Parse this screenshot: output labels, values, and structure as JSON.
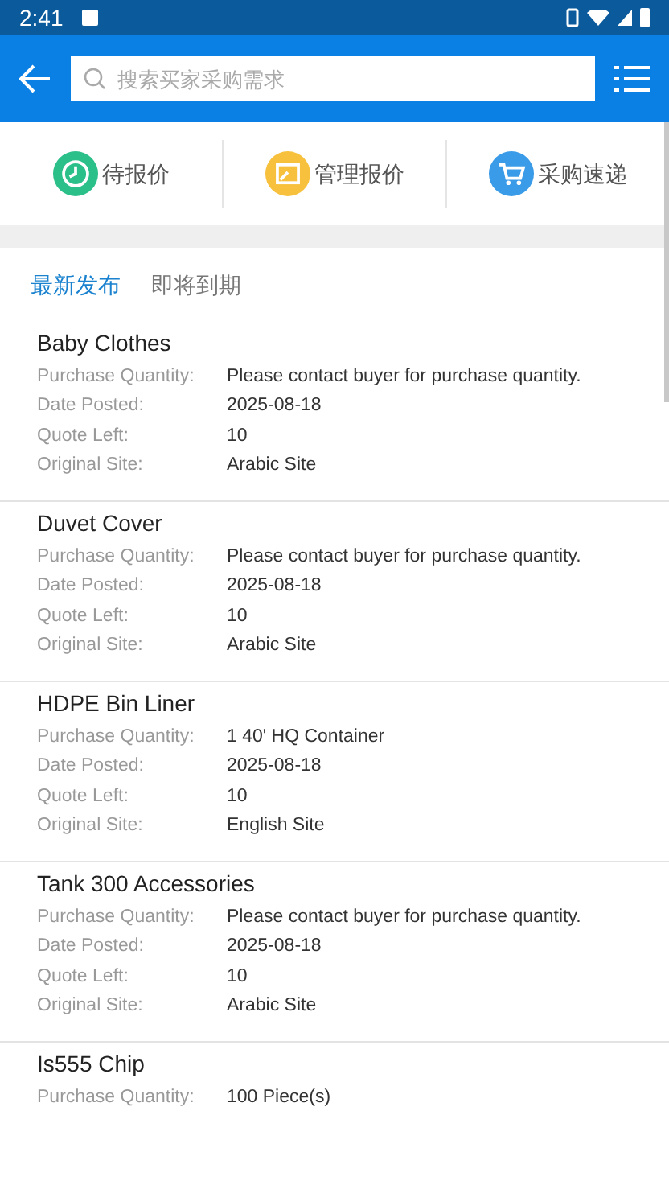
{
  "status_bar": {
    "time": "2:41"
  },
  "search": {
    "placeholder": "搜索买家采购需求"
  },
  "shortcuts": [
    {
      "label": "待报价",
      "kind": "clock",
      "color": "#2bbf8a"
    },
    {
      "label": "管理报价",
      "kind": "window",
      "color": "#f7c13e"
    },
    {
      "label": "采购速递",
      "kind": "cart",
      "color": "#3a9be8"
    }
  ],
  "tabs": [
    {
      "label": "最新发布",
      "selected": true
    },
    {
      "label": "即将到期",
      "selected": false
    }
  ],
  "items": [
    {
      "title": "Baby Clothes",
      "fields": [
        {
          "label": "Purchase Quantity:",
          "value": "Please contact buyer for purchase quantity."
        },
        {
          "label": "Date Posted:",
          "value": "2025-08-18"
        },
        {
          "label": "Quote Left:",
          "value": "10"
        },
        {
          "label": "Original Site:",
          "value": "Arabic Site"
        }
      ]
    },
    {
      "title": "Duvet Cover",
      "fields": [
        {
          "label": "Purchase Quantity:",
          "value": "Please contact buyer for purchase quantity."
        },
        {
          "label": "Date Posted:",
          "value": "2025-08-18"
        },
        {
          "label": "Quote Left:",
          "value": "10"
        },
        {
          "label": "Original Site:",
          "value": "Arabic Site"
        }
      ]
    },
    {
      "title": "HDPE Bin Liner",
      "fields": [
        {
          "label": "Purchase Quantity:",
          "value": "1 40' HQ Container"
        },
        {
          "label": "Date Posted:",
          "value": "2025-08-18"
        },
        {
          "label": "Quote Left:",
          "value": "10"
        },
        {
          "label": "Original Site:",
          "value": "English Site"
        }
      ]
    },
    {
      "title": "Tank 300 Accessories",
      "fields": [
        {
          "label": "Purchase Quantity:",
          "value": "Please contact buyer for purchase quantity."
        },
        {
          "label": "Date Posted:",
          "value": "2025-08-18"
        },
        {
          "label": "Quote Left:",
          "value": "10"
        },
        {
          "label": "Original Site:",
          "value": "Arabic Site"
        }
      ]
    },
    {
      "title": "Is555 Chip",
      "fields": [
        {
          "label": "Purchase Quantity:",
          "value": "100 Piece(s)"
        }
      ]
    }
  ]
}
